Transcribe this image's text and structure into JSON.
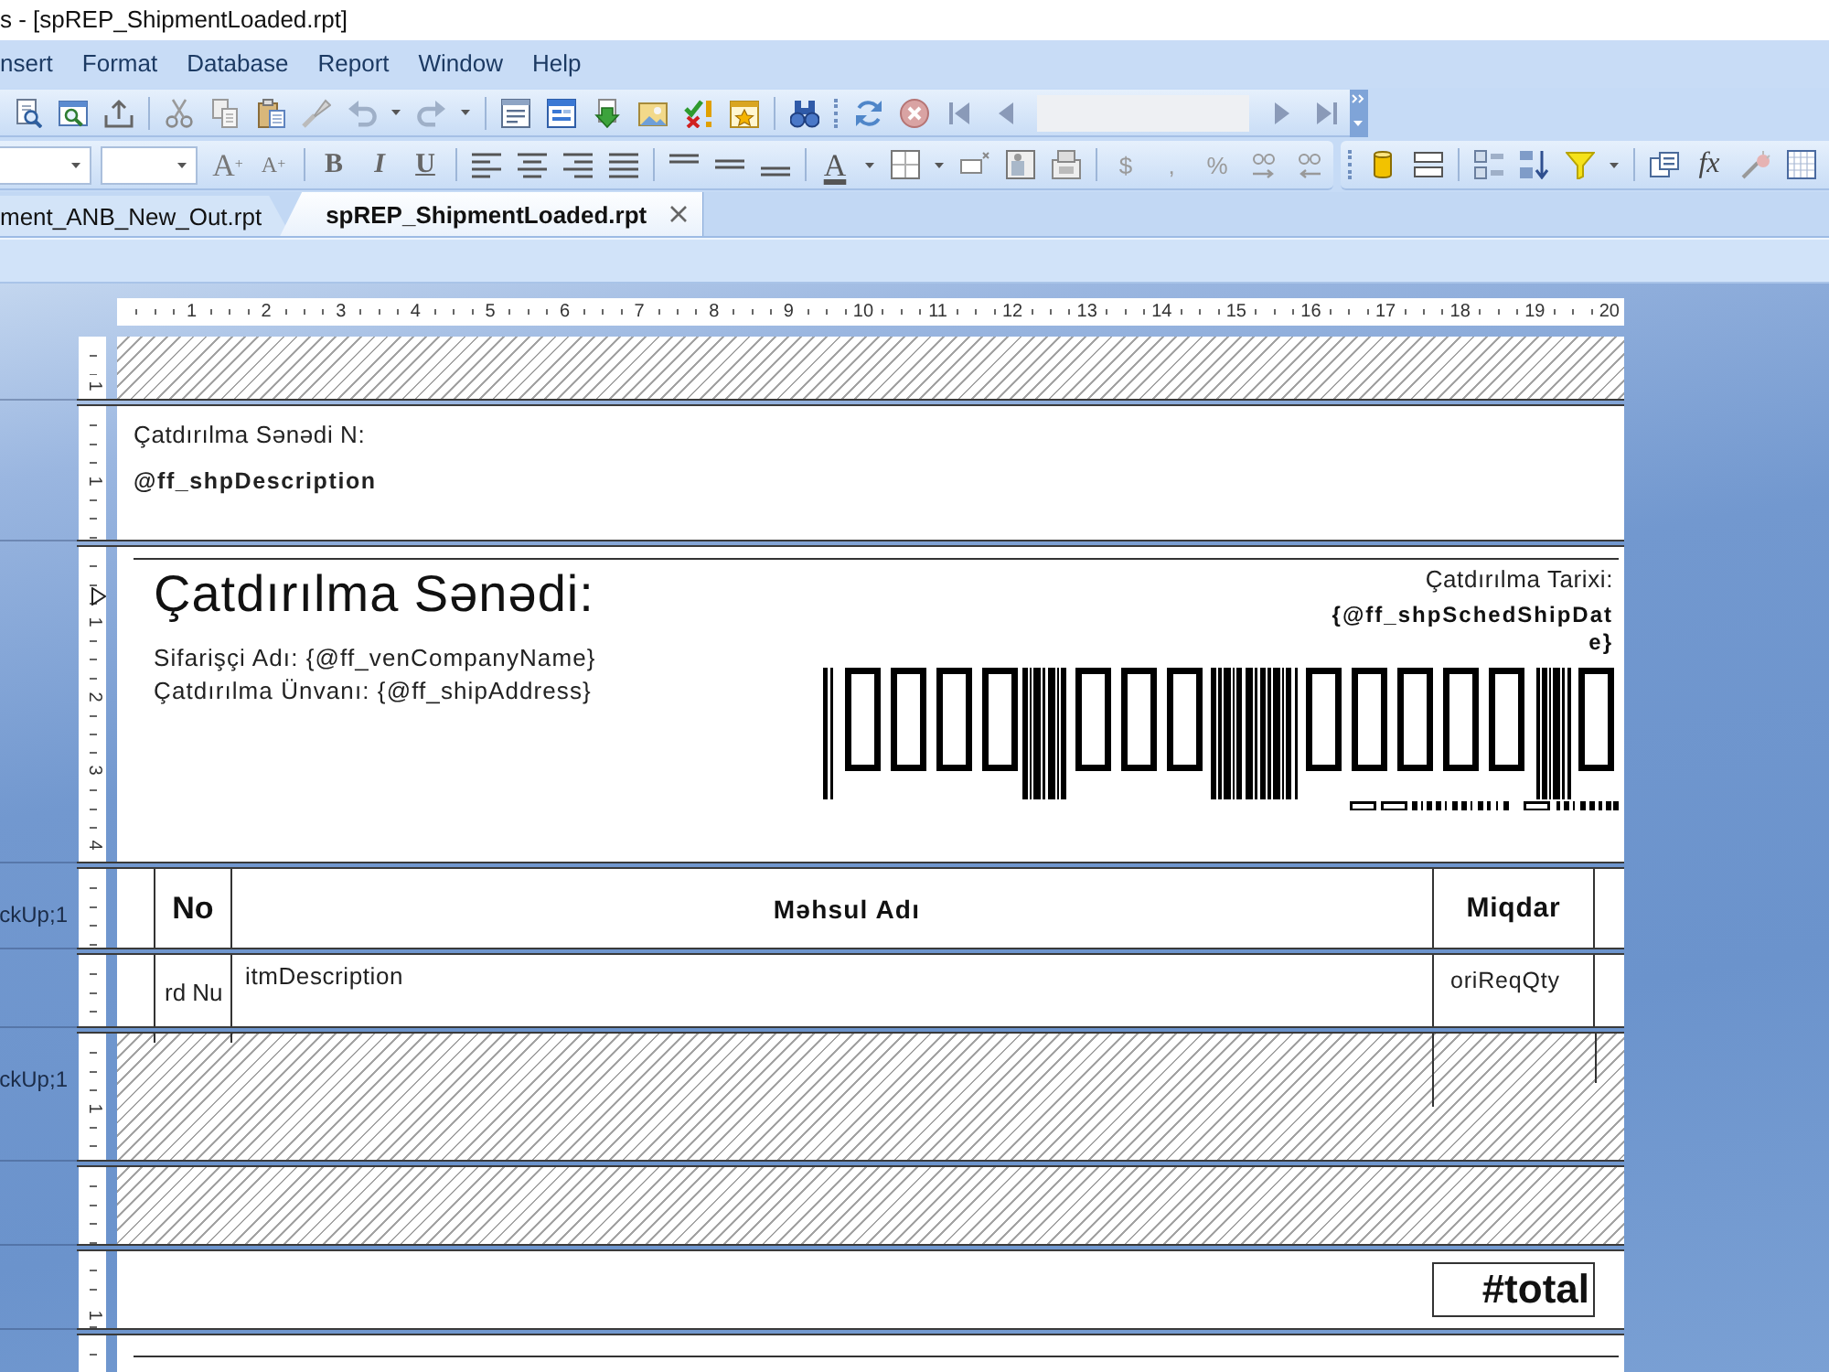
{
  "window": {
    "title": "s - [spREP_ShipmentLoaded.rpt]"
  },
  "menu": [
    "nsert",
    "Format",
    "Database",
    "Report",
    "Window",
    "Help"
  ],
  "format_toolbar": {
    "glyph_buttons": [
      "A$^{+}$",
      "A$^{+}$",
      "B",
      "I",
      "U",
      "A",
      "$",
      ",",
      "%",
      "fx"
    ]
  },
  "tabs": [
    {
      "label": "ment_ANB_New_Out.rpt",
      "selected": false
    },
    {
      "label": "spREP_ShipmentLoaded.rpt",
      "selected": true
    }
  ],
  "ruler": {
    "marks": [
      "1",
      "2",
      "3",
      "4",
      "5",
      "6",
      "7",
      "8",
      "9",
      "10",
      "11",
      "12",
      "13",
      "14",
      "15",
      "16",
      "17",
      "18",
      "19",
      "20"
    ]
  },
  "sections": [
    {
      "kind": "suppressed",
      "ruler_marks": [
        "1"
      ]
    },
    {
      "kind": "header_fields",
      "ruler_marks": [
        "1"
      ],
      "caption": "Çatdırılma Sənədi N:",
      "field": "@ff_shpDescription"
    },
    {
      "kind": "title_block",
      "ruler_marks": [
        "1",
        "2",
        "3",
        "4"
      ],
      "title": "Çatdırılma Sənədi:",
      "lines": [
        "Sifarişçi Adı: {@ff_venCompanyName}",
        "Çatdırılma Ünvanı: {@ff_shipAddress}"
      ],
      "date_caption": "Çatdırılma Tarixi:",
      "date_field": "{@ff_shpSchedShipDate}"
    },
    {
      "kind": "table_header",
      "label": "ckUp;1",
      "columns": [
        "No",
        "Məhsul Adı",
        "Miqdar"
      ]
    },
    {
      "kind": "table_row",
      "cells": [
        "rd Nu",
        "itmDescription",
        "oriReqQty"
      ]
    },
    {
      "kind": "suppressed_details",
      "label": "ckUp;1",
      "ruler_marks": [
        "1"
      ]
    },
    {
      "kind": "suppressed"
    },
    {
      "kind": "total",
      "ruler_marks": [
        "1"
      ],
      "total": "#total"
    },
    {
      "kind": "footer"
    }
  ]
}
